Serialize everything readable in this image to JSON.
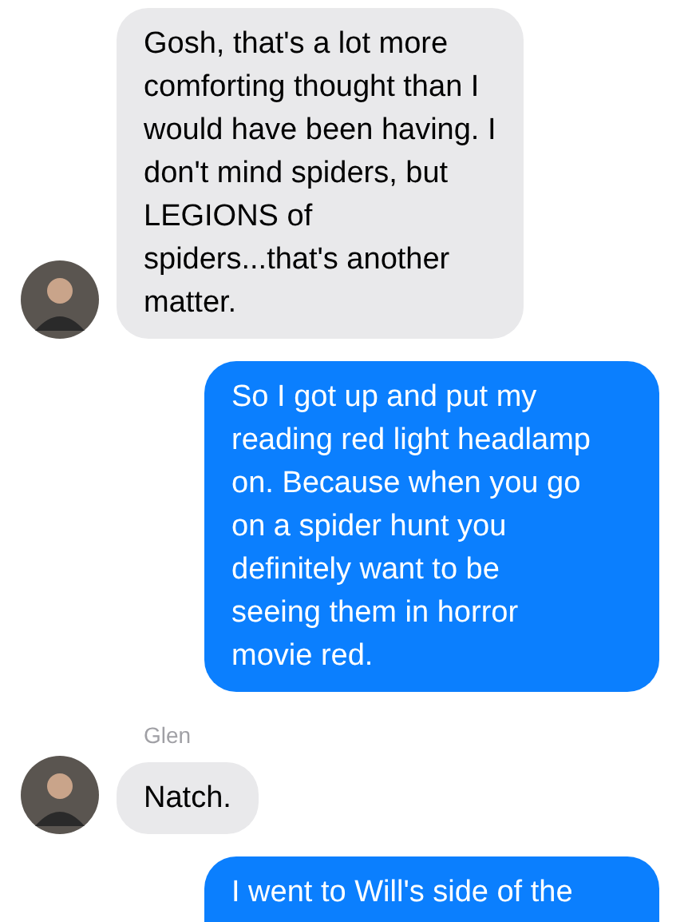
{
  "messages": [
    {
      "kind": "incoming",
      "avatar": true,
      "text": "Gosh, that's a lot more\ncomforting thought than I\nwould have been having.  I\ndon't mind spiders, but\nLEGIONS of\nspiders...that's another\nmatter."
    },
    {
      "kind": "outgoing",
      "text": "So I got up and put my\nreading red light headlamp\non.  Because when you go\non a spider hunt you\ndefinitely want to be\nseeing them in horror\nmovie red."
    },
    {
      "kind": "incoming",
      "sender": "Glen",
      "avatar": true,
      "text": "Natch."
    },
    {
      "kind": "outgoing",
      "text": "I went to Will's side of the"
    }
  ]
}
